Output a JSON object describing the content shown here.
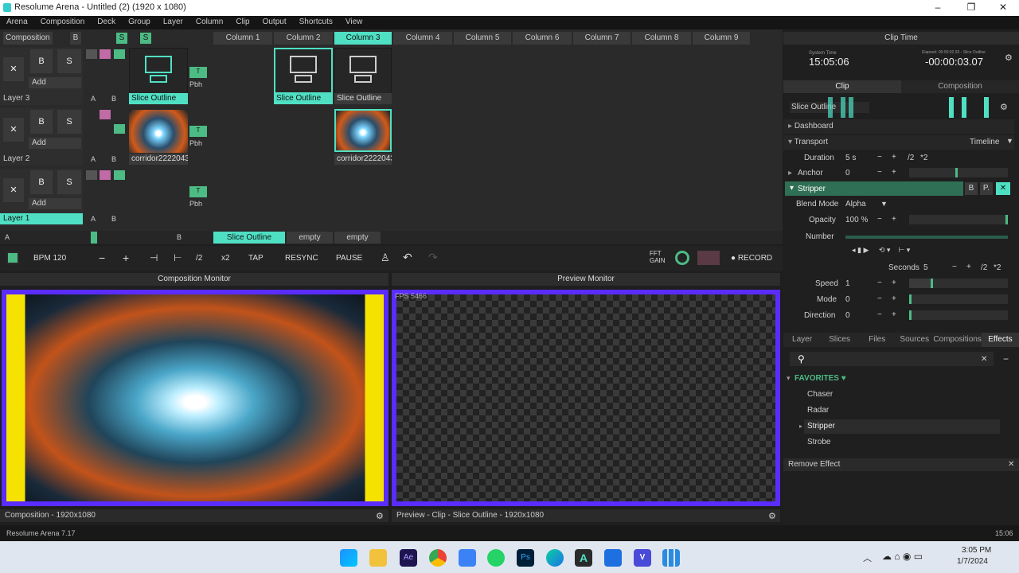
{
  "window": {
    "title": "Resolume Arena - Untitled (2) (1920 x 1080)",
    "minimize": "–",
    "maximize": "❐",
    "close": "✕"
  },
  "menu": [
    "Arena",
    "Composition",
    "Deck",
    "Group",
    "Layer",
    "Column",
    "Clip",
    "Output",
    "Shortcuts",
    "View"
  ],
  "grid": {
    "composition_label": "Composition",
    "b_label": "B",
    "s_label": "S",
    "columns": [
      "Column 1",
      "Column 2",
      "Column 3",
      "Column 4",
      "Column 5",
      "Column 6",
      "Column 7",
      "Column 8",
      "Column 9"
    ],
    "active_column": "Column 3",
    "layers": [
      {
        "name": "Layer 3",
        "x": "✕",
        "b": "B",
        "s": "S",
        "add": "Add",
        "a": "A",
        "bb": "B",
        "clips": [
          "Slice Outline",
          "Slice Outline",
          "Slice Outline"
        ]
      },
      {
        "name": "Layer 2",
        "x": "✕",
        "b": "B",
        "s": "S",
        "add": "Add",
        "a": "A",
        "bb": "B",
        "clips": [
          "corridor2222043...",
          "",
          "corridor2222043..."
        ]
      },
      {
        "name": "Layer 1",
        "x": "✕",
        "b": "B",
        "s": "S",
        "add": "Add",
        "a": "A",
        "bb": "B",
        "clips": []
      }
    ],
    "t_label": "T",
    "pbh_label": "Pbh",
    "deck_tabs": [
      "Slice Outline",
      "empty",
      "empty"
    ],
    "deck_a": "A",
    "deck_b": "B"
  },
  "toolbar": {
    "bpm": "BPM 120",
    "minus": "−",
    "plus": "+",
    "half": "/2",
    "double": "x2",
    "tap": "TAP",
    "resync": "RESYNC",
    "pause": "PAUSE",
    "fft": "FFT GAIN",
    "record": "● RECORD"
  },
  "monitors": {
    "composition_title": "Composition Monitor",
    "preview_title": "Preview Monitor",
    "fps": "FPS 5466",
    "composition_footer": "Composition - 1920x1080",
    "preview_footer": "Preview - Clip - Slice Outline - 1920x1080"
  },
  "right": {
    "clip_time_title": "Clip Time",
    "time": "15:05:06",
    "time_small": "System Time",
    "remaining": "-00:00:03.07",
    "remaining_small": "Elapsed: 00:00:02.93 - Slice Outline",
    "tab_clip": "Clip",
    "tab_composition": "Composition",
    "clip_name": "Slice Outline",
    "dashboard": "Dashboard",
    "transport": "Transport",
    "timeline": "Timeline",
    "duration_label": "Duration",
    "duration_value": "5 s",
    "anchor_label": "Anchor",
    "anchor_value": "0",
    "effect_name": "Stripper",
    "blend_label": "Blend Mode",
    "blend_value": "Alpha",
    "opacity_label": "Opacity",
    "opacity_value": "100 %",
    "number_label": "Number",
    "seconds_label": "Seconds",
    "seconds_value": "5",
    "speed_label": "Speed",
    "speed_value": "1",
    "mode_label": "Mode",
    "mode_value": "0",
    "direction_label": "Direction",
    "direction_value": "0",
    "div2": "/2",
    "mul2": "*2",
    "bottom_tabs": [
      "Layer",
      "Slices",
      "Files",
      "Sources",
      "Compositions",
      "Effects"
    ],
    "favorites": "FAVORITES ♥",
    "effects": [
      "Chaser",
      "Radar",
      "Stripper",
      "Strobe"
    ],
    "remove_effect": "Remove Effect"
  },
  "status": {
    "version": "Resolume Arena 7.17",
    "time": "15:06"
  },
  "taskbar": {
    "clock": "3:05 PM",
    "date": "1/7/2024",
    "accent": "#4fe0c4",
    "monitor_border": "#5a2cff"
  }
}
